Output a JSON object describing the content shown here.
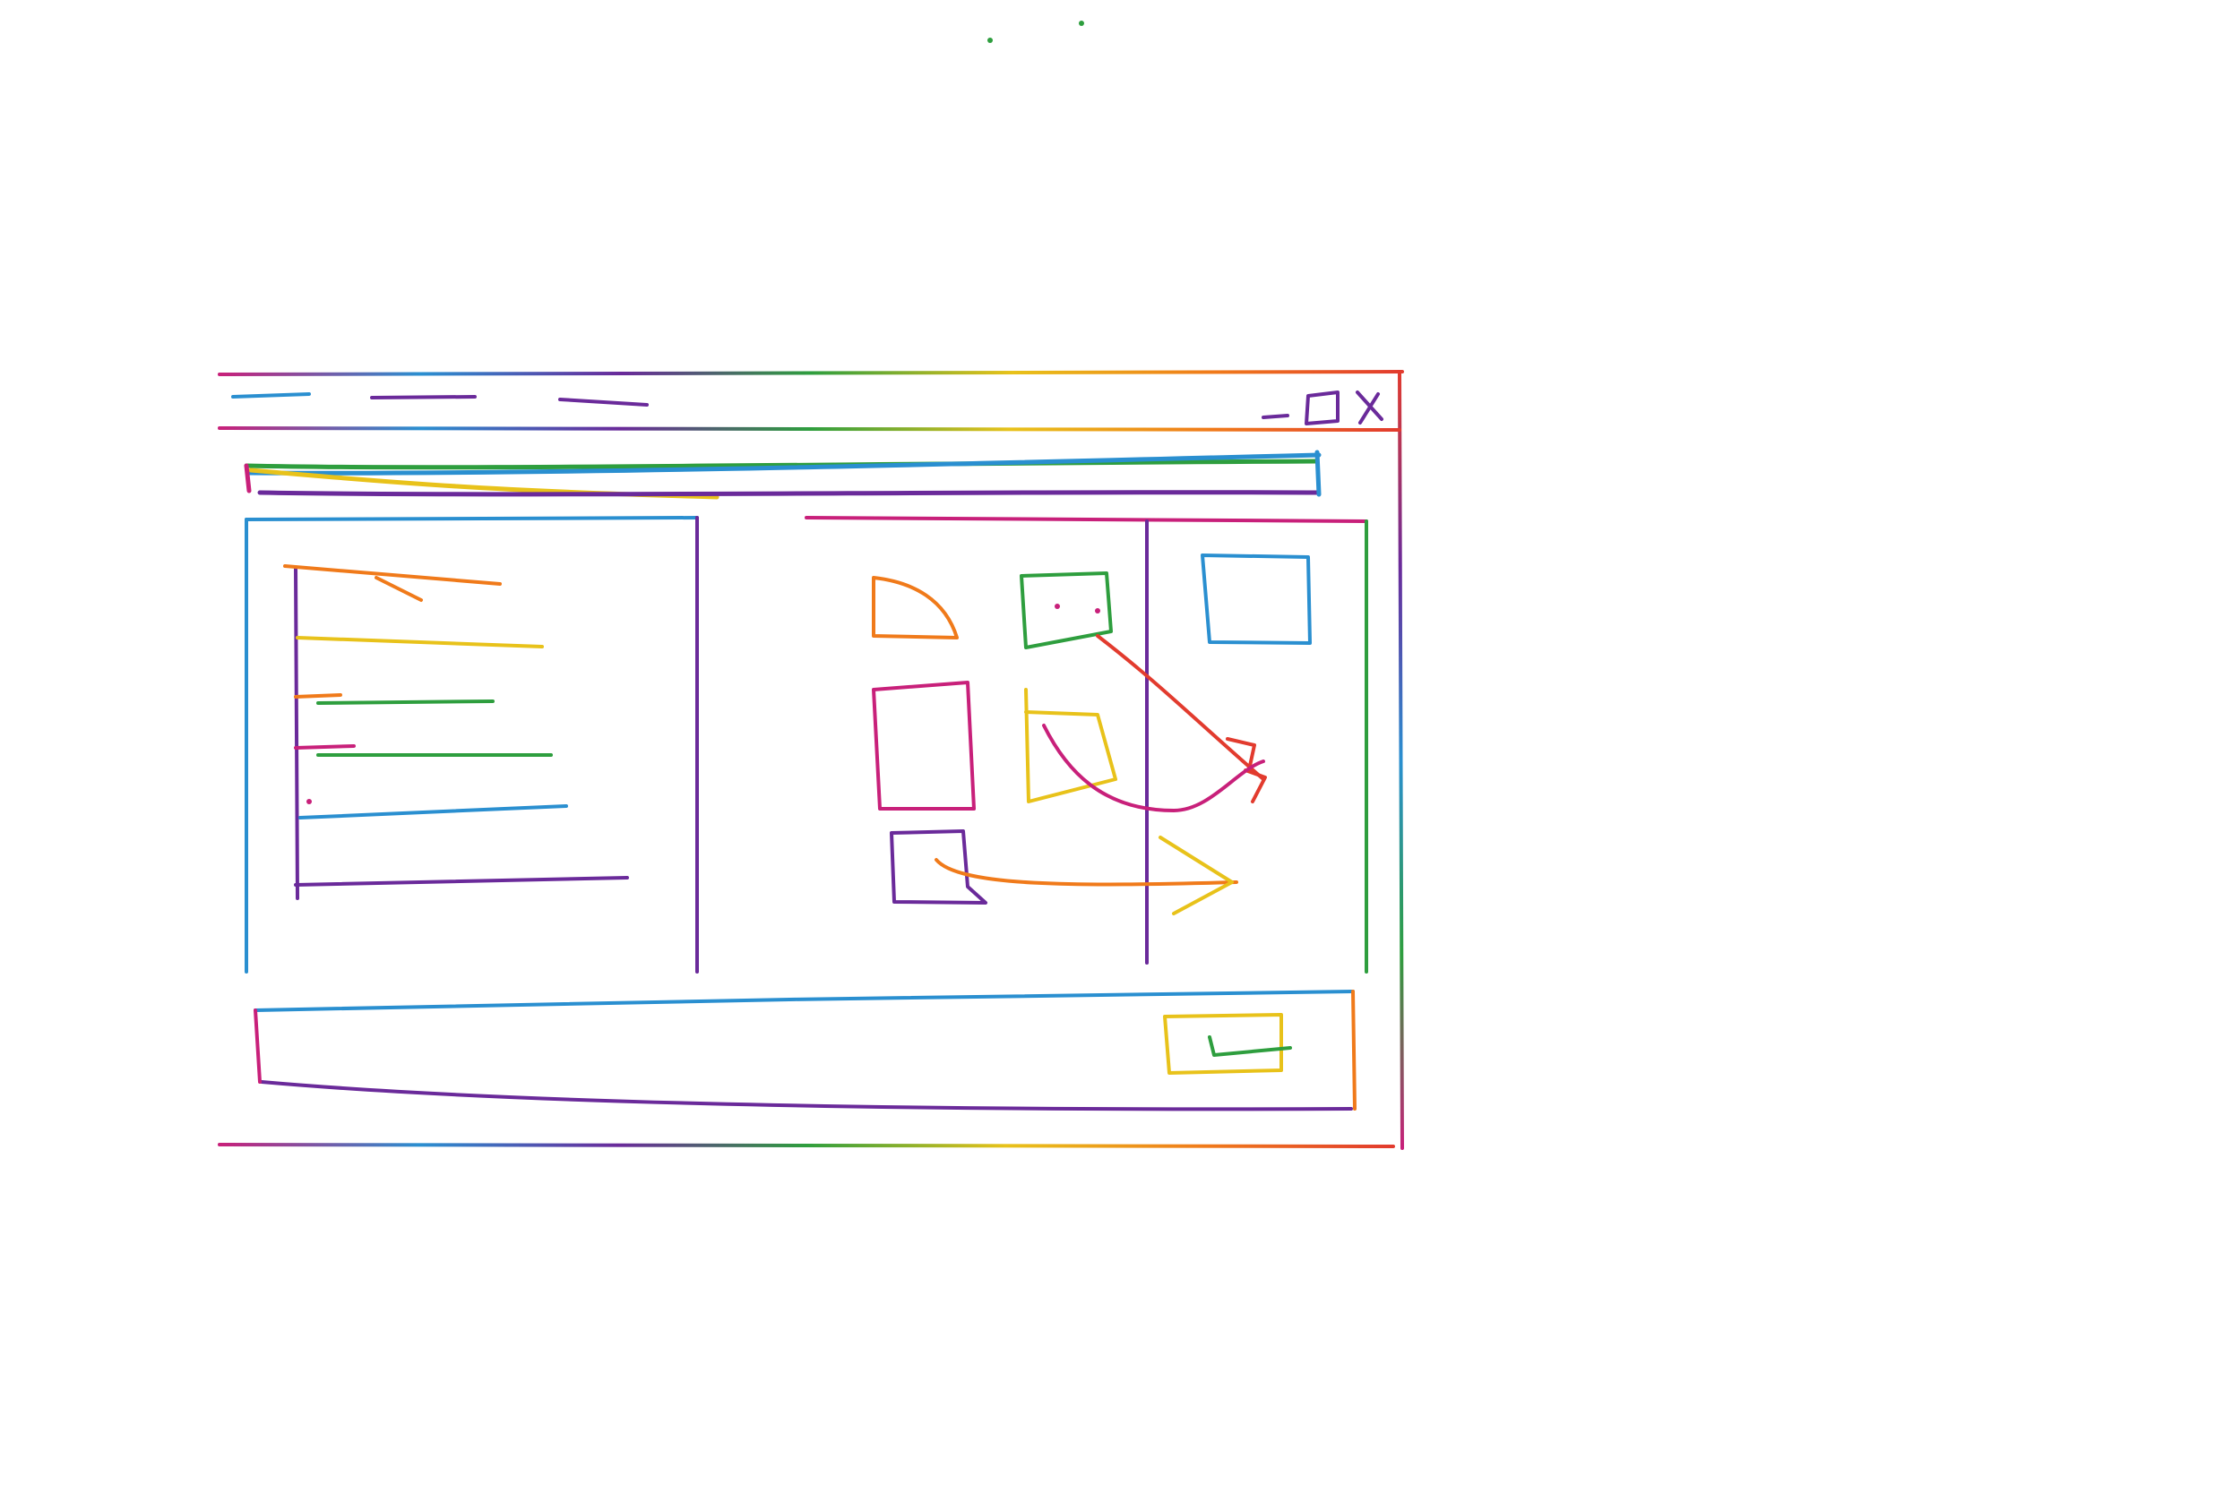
{
  "window": {
    "menu_items": [
      {
        "icon": "menu-scribble"
      },
      {
        "icon": "menu-scribble"
      },
      {
        "icon": "menu-scribble"
      }
    ],
    "controls": [
      "minimize-icon",
      "maximize-icon",
      "close-icon"
    ]
  },
  "left_panel": {
    "list_items_count": 6
  },
  "canvas": {
    "shapes": [
      "rounded-shape",
      "box-with-dots",
      "square",
      "rect",
      "note-shape",
      "small-box"
    ],
    "arrows": [
      "arrow-red",
      "arrow-orange"
    ]
  },
  "footer": {
    "send_icon": "send-button"
  },
  "colors": {
    "red": "#e23b2e",
    "orange": "#f07a1a",
    "yellow": "#e8c21a",
    "green": "#2e9e3e",
    "blue": "#2a8fd0",
    "purple": "#6a2a9a",
    "magenta": "#c8207a"
  }
}
